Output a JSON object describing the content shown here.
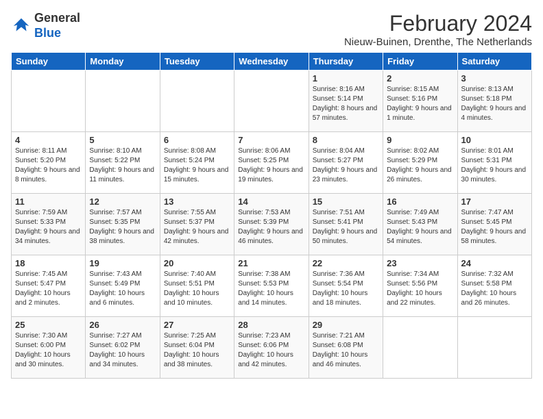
{
  "logo": {
    "line1": "General",
    "line2": "Blue"
  },
  "title": "February 2024",
  "location": "Nieuw-Buinen, Drenthe, The Netherlands",
  "days_of_week": [
    "Sunday",
    "Monday",
    "Tuesday",
    "Wednesday",
    "Thursday",
    "Friday",
    "Saturday"
  ],
  "weeks": [
    [
      {
        "day": "",
        "content": ""
      },
      {
        "day": "",
        "content": ""
      },
      {
        "day": "",
        "content": ""
      },
      {
        "day": "",
        "content": ""
      },
      {
        "day": "1",
        "content": "Sunrise: 8:16 AM\nSunset: 5:14 PM\nDaylight: 8 hours and 57 minutes."
      },
      {
        "day": "2",
        "content": "Sunrise: 8:15 AM\nSunset: 5:16 PM\nDaylight: 9 hours and 1 minute."
      },
      {
        "day": "3",
        "content": "Sunrise: 8:13 AM\nSunset: 5:18 PM\nDaylight: 9 hours and 4 minutes."
      }
    ],
    [
      {
        "day": "4",
        "content": "Sunrise: 8:11 AM\nSunset: 5:20 PM\nDaylight: 9 hours and 8 minutes."
      },
      {
        "day": "5",
        "content": "Sunrise: 8:10 AM\nSunset: 5:22 PM\nDaylight: 9 hours and 11 minutes."
      },
      {
        "day": "6",
        "content": "Sunrise: 8:08 AM\nSunset: 5:24 PM\nDaylight: 9 hours and 15 minutes."
      },
      {
        "day": "7",
        "content": "Sunrise: 8:06 AM\nSunset: 5:25 PM\nDaylight: 9 hours and 19 minutes."
      },
      {
        "day": "8",
        "content": "Sunrise: 8:04 AM\nSunset: 5:27 PM\nDaylight: 9 hours and 23 minutes."
      },
      {
        "day": "9",
        "content": "Sunrise: 8:02 AM\nSunset: 5:29 PM\nDaylight: 9 hours and 26 minutes."
      },
      {
        "day": "10",
        "content": "Sunrise: 8:01 AM\nSunset: 5:31 PM\nDaylight: 9 hours and 30 minutes."
      }
    ],
    [
      {
        "day": "11",
        "content": "Sunrise: 7:59 AM\nSunset: 5:33 PM\nDaylight: 9 hours and 34 minutes."
      },
      {
        "day": "12",
        "content": "Sunrise: 7:57 AM\nSunset: 5:35 PM\nDaylight: 9 hours and 38 minutes."
      },
      {
        "day": "13",
        "content": "Sunrise: 7:55 AM\nSunset: 5:37 PM\nDaylight: 9 hours and 42 minutes."
      },
      {
        "day": "14",
        "content": "Sunrise: 7:53 AM\nSunset: 5:39 PM\nDaylight: 9 hours and 46 minutes."
      },
      {
        "day": "15",
        "content": "Sunrise: 7:51 AM\nSunset: 5:41 PM\nDaylight: 9 hours and 50 minutes."
      },
      {
        "day": "16",
        "content": "Sunrise: 7:49 AM\nSunset: 5:43 PM\nDaylight: 9 hours and 54 minutes."
      },
      {
        "day": "17",
        "content": "Sunrise: 7:47 AM\nSunset: 5:45 PM\nDaylight: 9 hours and 58 minutes."
      }
    ],
    [
      {
        "day": "18",
        "content": "Sunrise: 7:45 AM\nSunset: 5:47 PM\nDaylight: 10 hours and 2 minutes."
      },
      {
        "day": "19",
        "content": "Sunrise: 7:43 AM\nSunset: 5:49 PM\nDaylight: 10 hours and 6 minutes."
      },
      {
        "day": "20",
        "content": "Sunrise: 7:40 AM\nSunset: 5:51 PM\nDaylight: 10 hours and 10 minutes."
      },
      {
        "day": "21",
        "content": "Sunrise: 7:38 AM\nSunset: 5:53 PM\nDaylight: 10 hours and 14 minutes."
      },
      {
        "day": "22",
        "content": "Sunrise: 7:36 AM\nSunset: 5:54 PM\nDaylight: 10 hours and 18 minutes."
      },
      {
        "day": "23",
        "content": "Sunrise: 7:34 AM\nSunset: 5:56 PM\nDaylight: 10 hours and 22 minutes."
      },
      {
        "day": "24",
        "content": "Sunrise: 7:32 AM\nSunset: 5:58 PM\nDaylight: 10 hours and 26 minutes."
      }
    ],
    [
      {
        "day": "25",
        "content": "Sunrise: 7:30 AM\nSunset: 6:00 PM\nDaylight: 10 hours and 30 minutes."
      },
      {
        "day": "26",
        "content": "Sunrise: 7:27 AM\nSunset: 6:02 PM\nDaylight: 10 hours and 34 minutes."
      },
      {
        "day": "27",
        "content": "Sunrise: 7:25 AM\nSunset: 6:04 PM\nDaylight: 10 hours and 38 minutes."
      },
      {
        "day": "28",
        "content": "Sunrise: 7:23 AM\nSunset: 6:06 PM\nDaylight: 10 hours and 42 minutes."
      },
      {
        "day": "29",
        "content": "Sunrise: 7:21 AM\nSunset: 6:08 PM\nDaylight: 10 hours and 46 minutes."
      },
      {
        "day": "",
        "content": ""
      },
      {
        "day": "",
        "content": ""
      }
    ]
  ]
}
